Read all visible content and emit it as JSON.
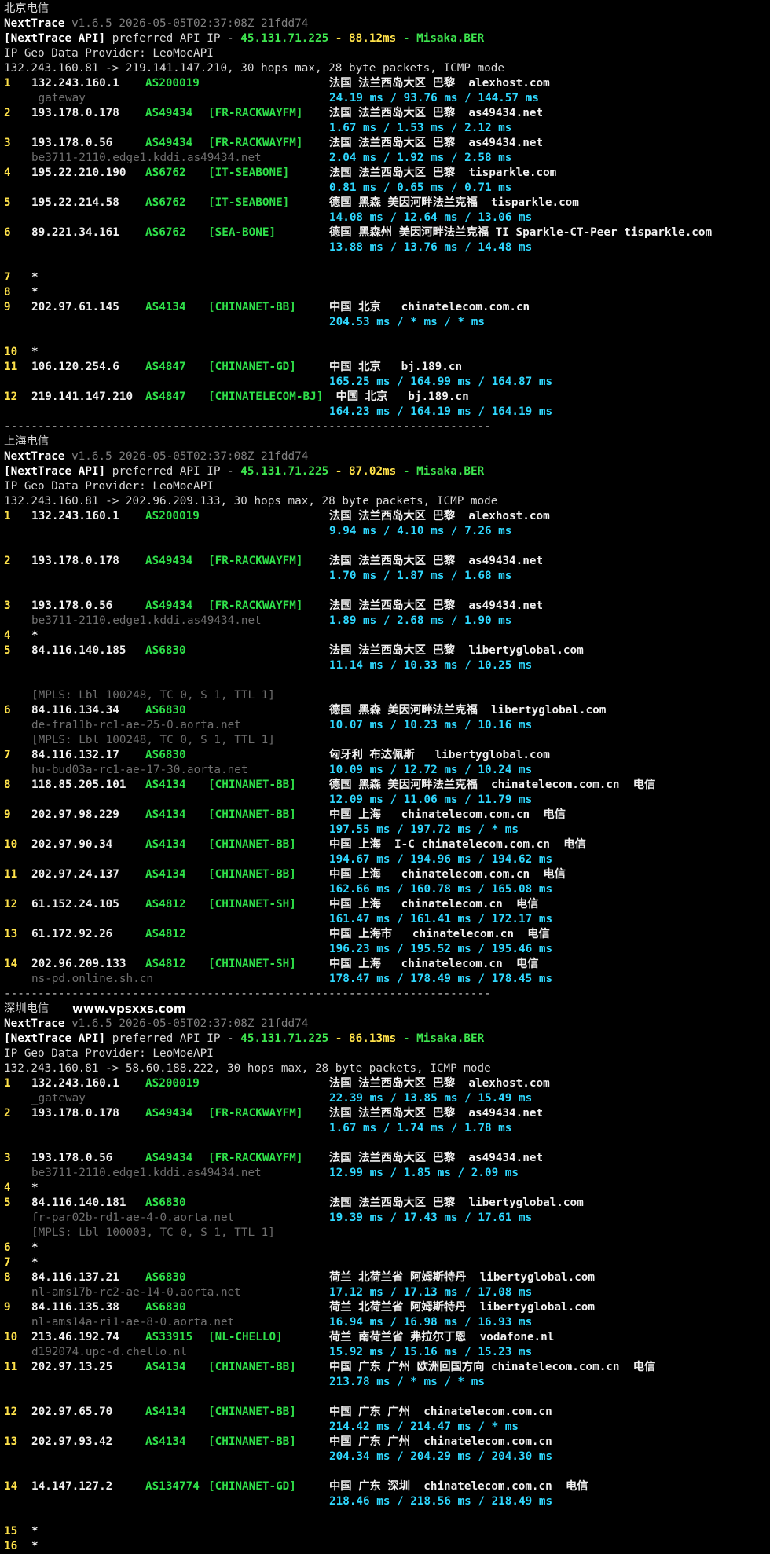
{
  "watermark": "www.vpsxxs.com",
  "separator": "------------------------------------------------------------------------",
  "header_common": {
    "tool": "NextTrace",
    "version": "v1.6.5 2026-05-05T02:37:08Z 21fdd74",
    "api_label": "[NextTrace API]",
    "api_text": " preferred API IP - ",
    "api_ip": "45.131.71.225",
    "api_dash1": " - ",
    "api_dash2": " - ",
    "api_node": "Misaka.BER",
    "geo_line": "IP Geo Data Provider: LeoMoeAPI"
  },
  "sections": [
    {
      "title": "北京电信",
      "api_ms": "88.12ms",
      "route": "132.243.160.81 -> 219.141.147.210, 30 hops max, 28 byte packets, ICMP mode",
      "hops": [
        {
          "n": "1",
          "ip": "132.243.160.1",
          "as": "AS200019",
          "tag": "",
          "geo": "法国 法兰西岛大区 巴黎  alexhost.com",
          "lat": "24.19 ms / 93.76 ms / 144.57 ms",
          "host": "_gateway"
        },
        {
          "n": "2",
          "ip": "193.178.0.178",
          "as": "AS49434",
          "tag": "[FR-RACKWAYFM]",
          "geo": "法国 法兰西岛大区 巴黎  as49434.net",
          "lat": "1.67 ms / 1.53 ms / 2.12 ms"
        },
        {
          "n": "3",
          "ip": "193.178.0.56",
          "as": "AS49434",
          "tag": "[FR-RACKWAYFM]",
          "geo": "法国 法兰西岛大区 巴黎  as49434.net",
          "lat": "2.04 ms / 1.92 ms / 2.58 ms",
          "host": "be3711-2110.edge1.kddi.as49434.net"
        },
        {
          "n": "4",
          "ip": "195.22.210.190",
          "as": "AS6762",
          "tag": "[IT-SEABONE]",
          "geo": "法国 法兰西岛大区 巴黎  tisparkle.com",
          "lat": "0.81 ms / 0.65 ms / 0.71 ms"
        },
        {
          "n": "5",
          "ip": "195.22.214.58",
          "as": "AS6762",
          "tag": "[IT-SEABONE]",
          "geo": "德国 黑森 美因河畔法兰克福  tisparkle.com",
          "lat": "14.08 ms / 12.64 ms / 13.06 ms"
        },
        {
          "n": "6",
          "ip": "89.221.34.161",
          "as": "AS6762",
          "tag": "[SEA-BONE]",
          "geo": "德国 黑森州 美因河畔法兰克福 TI Sparkle-CT-Peer tisparkle.com",
          "lat": "13.88 ms / 13.76 ms / 14.48 ms",
          "gap": true
        },
        {
          "n": "7",
          "star": "*"
        },
        {
          "n": "8",
          "star": "*"
        },
        {
          "n": "9",
          "ip": "202.97.61.145",
          "as": "AS4134",
          "tag": "[CHINANET-BB]",
          "geo": "中国 北京   chinatelecom.com.cn",
          "lat": "204.53 ms / * ms / * ms",
          "gap": true
        },
        {
          "n": "10",
          "star": "*"
        },
        {
          "n": "11",
          "ip": "106.120.254.6",
          "as": "AS4847",
          "tag": "[CHINANET-GD]",
          "geo": "中国 北京   bj.189.cn",
          "lat": "165.25 ms / 164.99 ms / 164.87 ms"
        },
        {
          "n": "12",
          "ip": "219.141.147.210",
          "as": "AS4847",
          "tag": "[CHINATELECOM-BJ]",
          "geo": " 中国 北京   bj.189.cn",
          "lat": "164.23 ms / 164.19 ms / 164.19 ms"
        }
      ]
    },
    {
      "title": "上海电信",
      "api_ms": "87.02ms",
      "route": "132.243.160.81 -> 202.96.209.133, 30 hops max, 28 byte packets, ICMP mode",
      "hops": [
        {
          "n": "1",
          "ip": "132.243.160.1",
          "as": "AS200019",
          "tag": "",
          "geo": "法国 法兰西岛大区 巴黎  alexhost.com",
          "lat": "9.94 ms / 4.10 ms / 7.26 ms",
          "gap": true
        },
        {
          "n": "2",
          "ip": "193.178.0.178",
          "as": "AS49434",
          "tag": "[FR-RACKWAYFM]",
          "geo": "法国 法兰西岛大区 巴黎  as49434.net",
          "lat": "1.70 ms / 1.87 ms / 1.68 ms",
          "gap": true
        },
        {
          "n": "3",
          "ip": "193.178.0.56",
          "as": "AS49434",
          "tag": "[FR-RACKWAYFM]",
          "geo": "法国 法兰西岛大区 巴黎  as49434.net",
          "lat": "1.89 ms / 2.68 ms / 1.90 ms",
          "host": "be3711-2110.edge1.kddi.as49434.net"
        },
        {
          "n": "4",
          "star": "*"
        },
        {
          "n": "5",
          "ip": "84.116.140.185",
          "as": "AS6830",
          "tag": "",
          "geo": "法国 法兰西岛大区 巴黎  libertyglobal.com",
          "lat": "11.14 ms / 10.33 ms / 10.25 ms",
          "mpls": "[MPLS: Lbl 100248, TC 0, S 1, TTL 1]",
          "mpls_blank": true
        },
        {
          "n": "6",
          "ip": "84.116.134.34",
          "as": "AS6830",
          "tag": "",
          "geo": "德国 黑森 美因河畔法兰克福  libertyglobal.com",
          "lat": "10.07 ms / 10.23 ms / 10.16 ms",
          "host": "de-fra11b-rc1-ae-25-0.aorta.net",
          "mpls": "[MPLS: Lbl 100248, TC 0, S 1, TTL 1]"
        },
        {
          "n": "7",
          "ip": "84.116.132.17",
          "as": "AS6830",
          "tag": "",
          "geo": "匈牙利 布达佩斯   libertyglobal.com",
          "lat": "10.09 ms / 12.72 ms / 10.24 ms",
          "host": "hu-bud03a-rc1-ae-17-30.aorta.net"
        },
        {
          "n": "8",
          "ip": "118.85.205.101",
          "as": "AS4134",
          "tag": "[CHINANET-BB]",
          "geo": "德国 黑森 美因河畔法兰克福  chinatelecom.com.cn  电信",
          "lat": "12.09 ms / 11.06 ms / 11.79 ms"
        },
        {
          "n": "9",
          "ip": "202.97.98.229",
          "as": "AS4134",
          "tag": "[CHINANET-BB]",
          "geo": "中国 上海   chinatelecom.com.cn  电信",
          "lat": "197.55 ms / 197.72 ms / * ms"
        },
        {
          "n": "10",
          "ip": "202.97.90.34",
          "as": "AS4134",
          "tag": "[CHINANET-BB]",
          "geo": "中国 上海  I-C chinatelecom.com.cn  电信",
          "lat": "194.67 ms / 194.96 ms / 194.62 ms"
        },
        {
          "n": "11",
          "ip": "202.97.24.137",
          "as": "AS4134",
          "tag": "[CHINANET-BB]",
          "geo": "中国 上海   chinatelecom.com.cn  电信",
          "lat": "162.66 ms / 160.78 ms / 165.08 ms"
        },
        {
          "n": "12",
          "ip": "61.152.24.105",
          "as": "AS4812",
          "tag": "[CHINANET-SH]",
          "geo": "中国 上海   chinatelecom.cn  电信",
          "lat": "161.47 ms / 161.41 ms / 172.17 ms"
        },
        {
          "n": "13",
          "ip": "61.172.92.26",
          "as": "AS4812",
          "tag": "",
          "geo": "中国 上海市   chinatelecom.cn  电信",
          "lat": "196.23 ms / 195.52 ms / 195.46 ms"
        },
        {
          "n": "14",
          "ip": "202.96.209.133",
          "as": "AS4812",
          "tag": "[CHINANET-SH]",
          "geo": "中国 上海   chinatelecom.cn  电信",
          "lat": "178.47 ms / 178.49 ms / 178.45 ms",
          "host": "ns-pd.online.sh.cn"
        }
      ]
    },
    {
      "title": "深圳电信",
      "api_ms": "86.13ms",
      "route": "132.243.160.81 -> 58.60.188.222, 30 hops max, 28 byte packets, ICMP mode",
      "hops": [
        {
          "n": "1",
          "ip": "132.243.160.1",
          "as": "AS200019",
          "tag": "",
          "geo": "法国 法兰西岛大区 巴黎  alexhost.com",
          "lat": "22.39 ms / 13.85 ms / 15.49 ms",
          "host": "_gateway"
        },
        {
          "n": "2",
          "ip": "193.178.0.178",
          "as": "AS49434",
          "tag": "[FR-RACKWAYFM]",
          "geo": "法国 法兰西岛大区 巴黎  as49434.net",
          "lat": "1.67 ms / 1.74 ms / 1.78 ms",
          "gap": true
        },
        {
          "n": "3",
          "ip": "193.178.0.56",
          "as": "AS49434",
          "tag": "[FR-RACKWAYFM]",
          "geo": "法国 法兰西岛大区 巴黎  as49434.net",
          "lat": "12.99 ms / 1.85 ms / 2.09 ms",
          "host": "be3711-2110.edge1.kddi.as49434.net"
        },
        {
          "n": "4",
          "star": "*"
        },
        {
          "n": "5",
          "ip": "84.116.140.181",
          "as": "AS6830",
          "tag": "",
          "geo": "法国 法兰西岛大区 巴黎  libertyglobal.com",
          "lat": "19.39 ms / 17.43 ms / 17.61 ms",
          "host": "fr-par02b-rd1-ae-4-0.aorta.net",
          "mpls": "[MPLS: Lbl 100003, TC 0, S 1, TTL 1]"
        },
        {
          "n": "6",
          "star": "*"
        },
        {
          "n": "7",
          "star": "*"
        },
        {
          "n": "8",
          "ip": "84.116.137.21",
          "as": "AS6830",
          "tag": "",
          "geo": "荷兰 北荷兰省 阿姆斯特丹  libertyglobal.com",
          "lat": "17.12 ms / 17.13 ms / 17.08 ms",
          "host": "nl-ams17b-rc2-ae-14-0.aorta.net"
        },
        {
          "n": "9",
          "ip": "84.116.135.38",
          "as": "AS6830",
          "tag": "",
          "geo": "荷兰 北荷兰省 阿姆斯特丹  libertyglobal.com",
          "lat": "16.94 ms / 16.98 ms / 16.93 ms",
          "host": "nl-ams14a-ri1-ae-8-0.aorta.net"
        },
        {
          "n": "10",
          "ip": "213.46.192.74",
          "as": "AS33915",
          "tag": "[NL-CHELLO]",
          "geo": "荷兰 南荷兰省 弗拉尔丁恩  vodafone.nl",
          "lat": "15.92 ms / 15.16 ms / 15.23 ms",
          "host": "d192074.upc-d.chello.nl"
        },
        {
          "n": "11",
          "ip": "202.97.13.25",
          "as": "AS4134",
          "tag": "[CHINANET-BB]",
          "geo": "中国 广东 广州 欧洲回国方向 chinatelecom.com.cn  电信",
          "lat": "213.78 ms / * ms / * ms",
          "gap": true
        },
        {
          "n": "12",
          "ip": "202.97.65.70",
          "as": "AS4134",
          "tag": "[CHINANET-BB]",
          "geo": "中国 广东 广州  chinatelecom.com.cn",
          "lat": "214.42 ms / 214.47 ms / * ms"
        },
        {
          "n": "13",
          "ip": "202.97.93.42",
          "as": "AS4134",
          "tag": "[CHINANET-BB]",
          "geo": "中国 广东 广州  chinatelecom.com.cn",
          "lat": "204.34 ms / 204.29 ms / 204.30 ms",
          "gap": true
        },
        {
          "n": "14",
          "ip": "14.147.127.2",
          "as": "AS134774",
          "tag": "[CHINANET-GD]",
          "geo": "中国 广东 深圳  chinatelecom.com.cn  电信",
          "lat": "218.46 ms / 218.56 ms / 218.49 ms",
          "gap": true
        },
        {
          "n": "15",
          "star": "*"
        },
        {
          "n": "16",
          "star": "*"
        }
      ]
    }
  ]
}
